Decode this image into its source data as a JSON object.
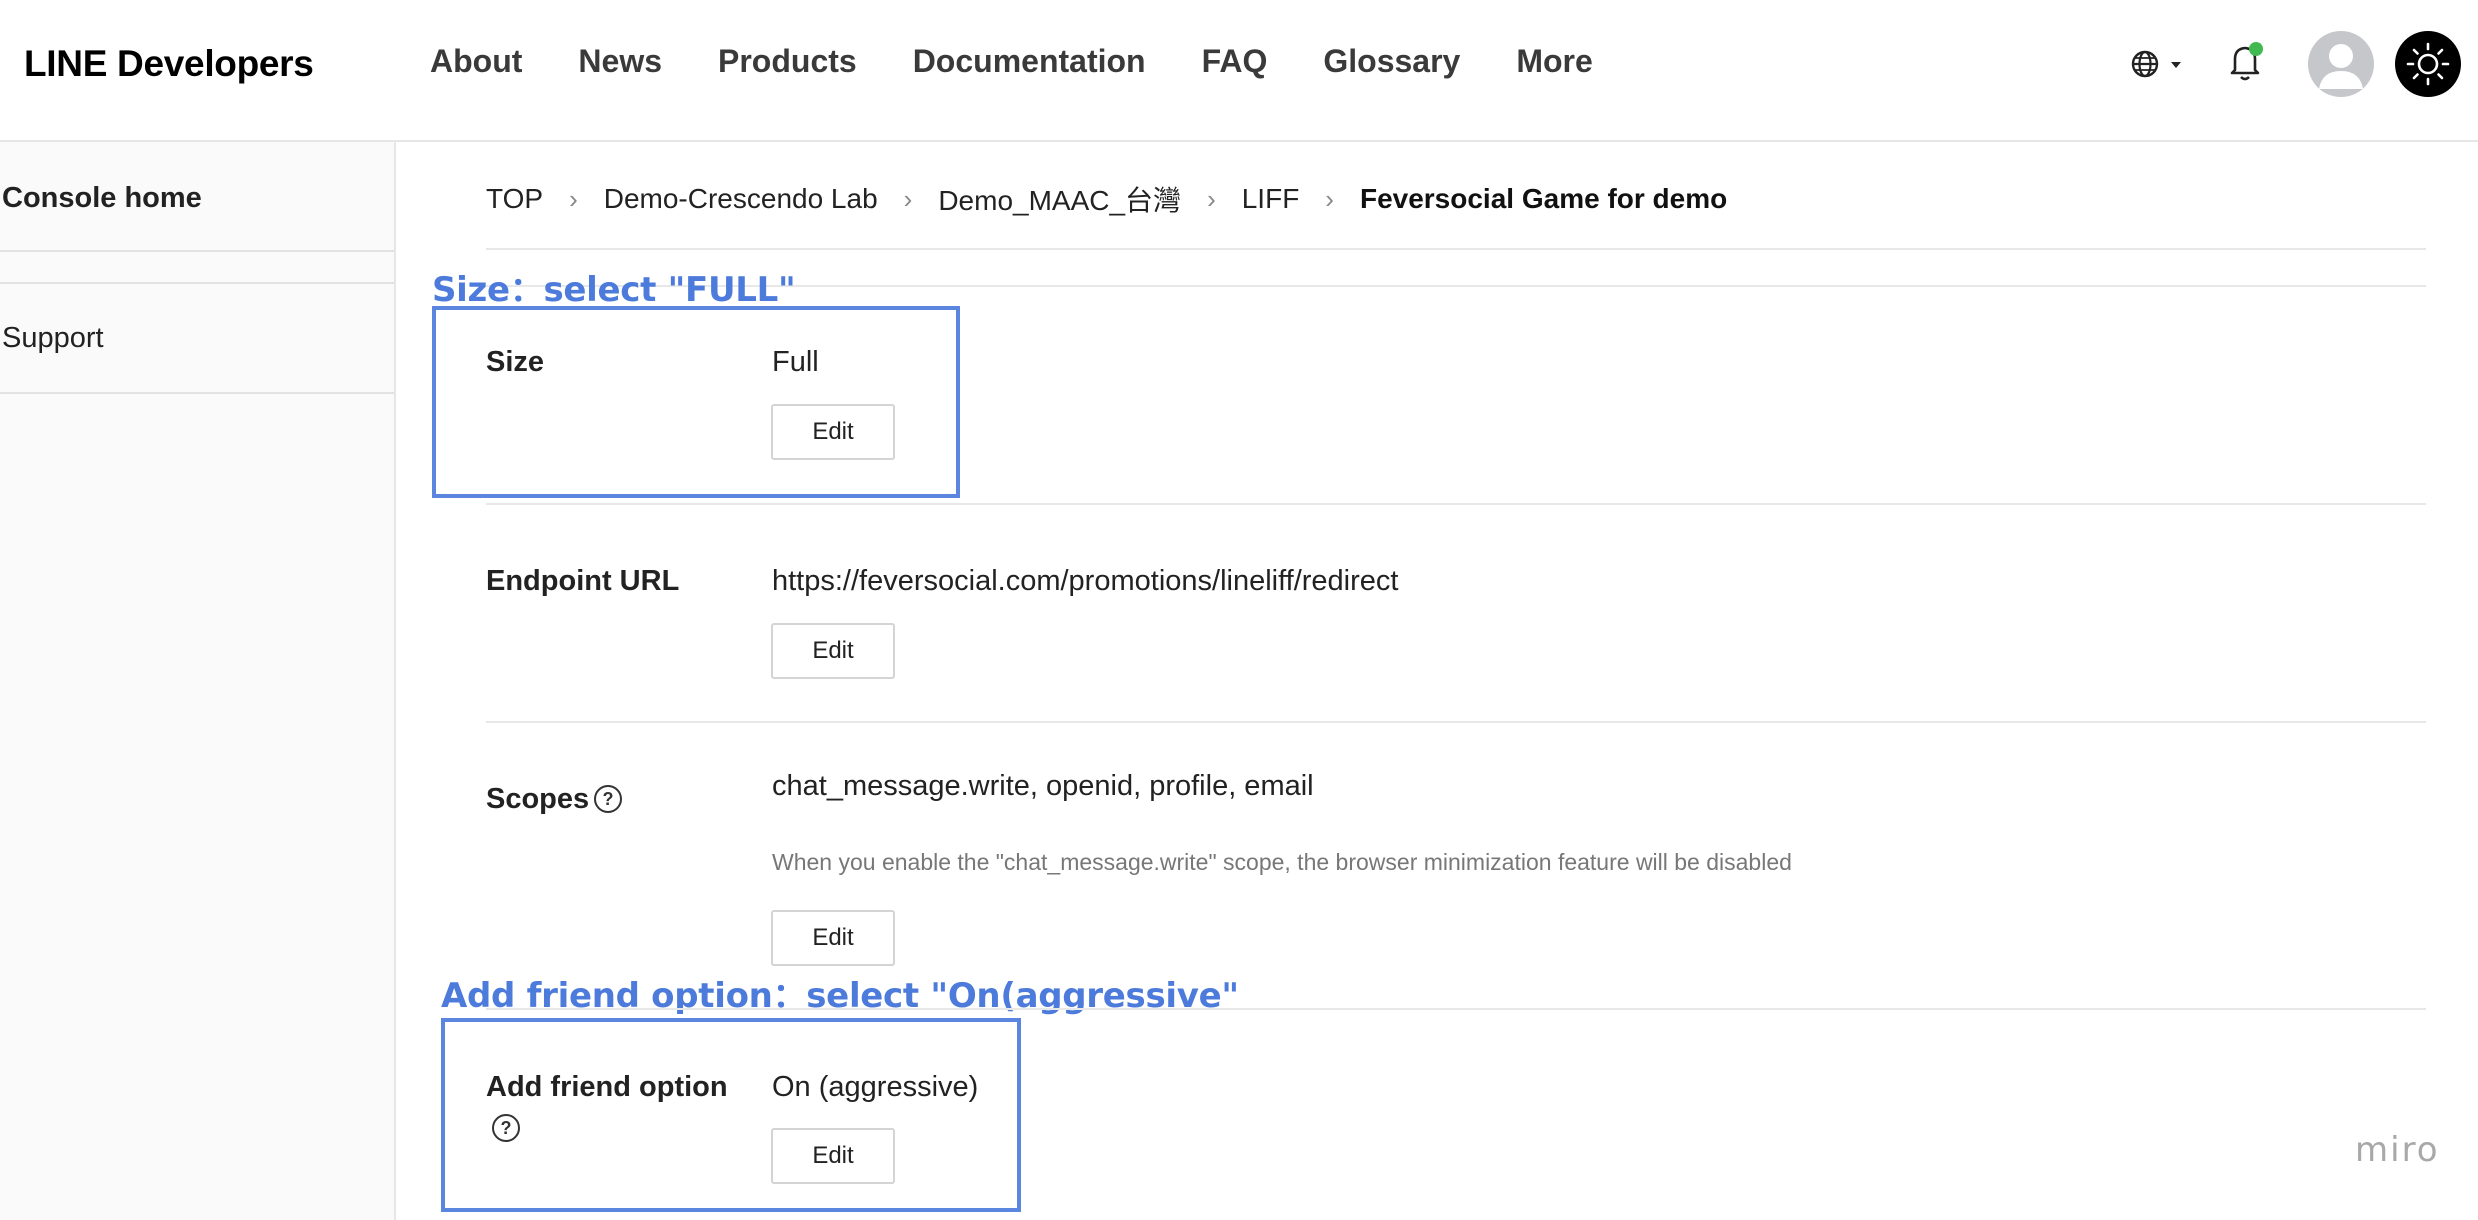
{
  "header": {
    "logo": "LINE Developers",
    "nav": [
      "About",
      "News",
      "Products",
      "Documentation",
      "FAQ",
      "Glossary",
      "More"
    ]
  },
  "sidebar": {
    "items": [
      {
        "label": "Console home"
      },
      {
        "label": "Support"
      }
    ]
  },
  "breadcrumb": {
    "items": [
      "TOP",
      "Demo-Crescendo Lab",
      "Demo_MAAC_台灣",
      "LIFF"
    ],
    "current": "Feversocial Game for demo"
  },
  "rows": {
    "size": {
      "label": "Size",
      "value": "Full",
      "button": "Edit"
    },
    "endpoint": {
      "label": "Endpoint URL",
      "value": "https://feversocial.com/promotions/lineliff/redirect",
      "button": "Edit"
    },
    "scopes": {
      "label": "Scopes",
      "value": "chat_message.write, openid, profile, email",
      "note": "When you enable the \"chat_message.write\" scope, the browser minimization feature will be disabled",
      "button": "Edit"
    },
    "add_friend": {
      "label": "Add friend option",
      "value": "On (aggressive)",
      "button": "Edit"
    }
  },
  "annotations": {
    "size": "Size：select \"FULL\"",
    "add_friend": "Add friend option：select \"On(aggressive\""
  },
  "watermark": "miro",
  "colors": {
    "annotation": "#5b86e0",
    "notification_dot": "#3fb950"
  }
}
